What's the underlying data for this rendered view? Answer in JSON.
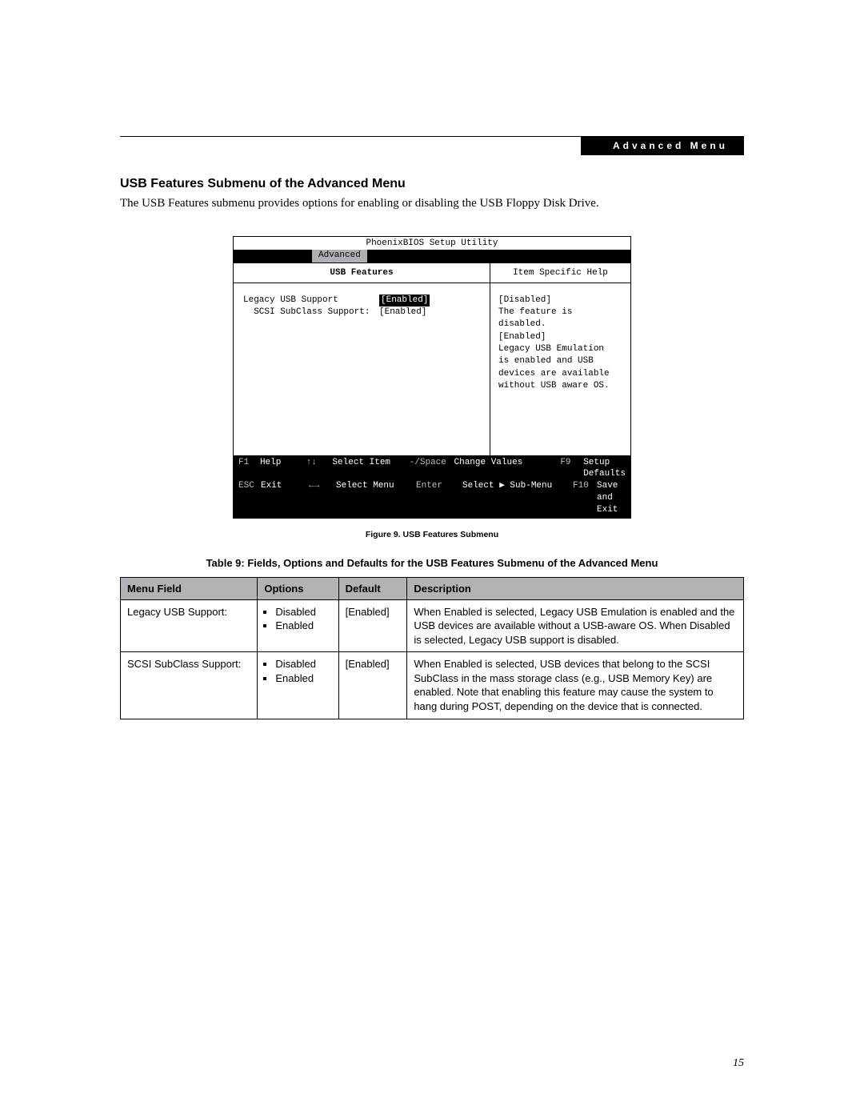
{
  "header": {
    "tag": "Advanced Menu"
  },
  "section": {
    "title": "USB Features Submenu of the Advanced Menu",
    "intro": "The USB Features submenu provides options for enabling or disabling the USB Floppy Disk Drive."
  },
  "bios": {
    "utility_title": "PhoenixBIOS Setup Utility",
    "active_menu": "Advanced",
    "submenu_title": "USB Features",
    "help_title": "Item Specific Help",
    "items": [
      {
        "label": "Legacy USB Support",
        "value": "[Enabled]",
        "selected": true
      },
      {
        "label": "  SCSI SubClass Support:",
        "value": "[Enabled]",
        "selected": false
      }
    ],
    "help_lines": [
      "[Disabled]",
      "The feature is disabled.",
      "",
      "[Enabled]",
      "Legacy USB Emulation",
      "is enabled and USB",
      "devices are available",
      "without USB aware OS."
    ],
    "footer": {
      "r1": {
        "k1": "F1",
        "v1": "Help",
        "k2": "↑↓",
        "v2": "Select Item",
        "k3": "-/Space",
        "v3": "Change Values",
        "k4": "F9",
        "v4": "Setup Defaults"
      },
      "r2": {
        "k1": "ESC",
        "v1": "Exit",
        "k2": "←→",
        "v2": "Select Menu",
        "k3": "Enter",
        "v3": "Select ▶ Sub-Menu",
        "k4": "F10",
        "v4": "Save and Exit"
      }
    }
  },
  "figure_caption": "Figure 9.  USB Features Submenu",
  "table_caption": "Table 9: Fields, Options and Defaults for the USB Features Submenu of the Advanced Menu",
  "table": {
    "headers": [
      "Menu Field",
      "Options",
      "Default",
      "Description"
    ],
    "rows": [
      {
        "menu_field": "Legacy USB Support:",
        "options": [
          "Disabled",
          "Enabled"
        ],
        "default": "[Enabled]",
        "description": "When Enabled is selected, Legacy USB Emulation is enabled and the USB devices are available without a USB-aware OS. When Disabled is selected, Legacy USB support is disabled."
      },
      {
        "menu_field": "SCSI SubClass Support:",
        "options": [
          "Disabled",
          "Enabled"
        ],
        "default": "[Enabled]",
        "description": "When Enabled is selected, USB devices that belong to the SCSI SubClass in the mass storage class (e.g., USB Memory Key) are enabled. Note that enabling this feature may cause the system to hang during POST, depending on the device that is connected."
      }
    ]
  },
  "page_number": "15"
}
